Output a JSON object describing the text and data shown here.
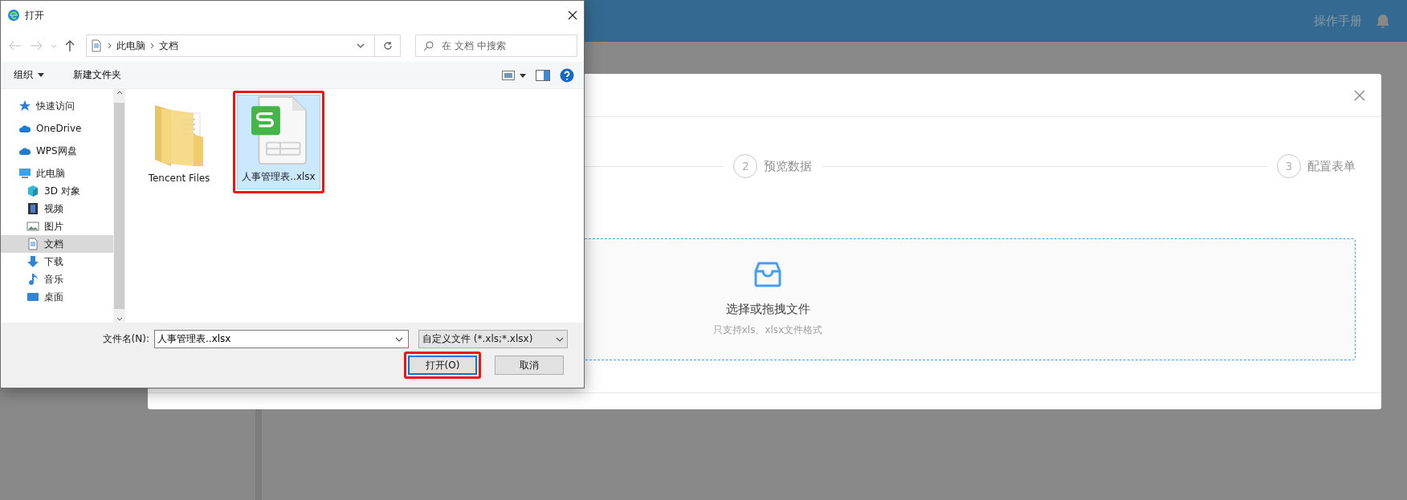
{
  "app_header": {
    "links": [
      "操作手册"
    ]
  },
  "import_modal": {
    "steps": [
      {
        "number": "2",
        "label": "预览数据"
      },
      {
        "number": "3",
        "label": "配置表单"
      }
    ],
    "upload": {
      "title": "选择或拖拽文件",
      "hint": "只支持xls、xlsx文件格式"
    }
  },
  "file_dialog": {
    "title": "打开",
    "path": [
      "此电脑",
      "文档"
    ],
    "search": {
      "placeholder": "在 文档 中搜索"
    },
    "toolbar": [
      {
        "label": "组织",
        "kind": "menu"
      },
      {
        "label": "新建文件夹",
        "kind": "plain"
      }
    ],
    "sidebar": [
      {
        "label": "快速访问",
        "kind": "star",
        "selected": false
      },
      {
        "label": "OneDrive",
        "kind": "cloud",
        "selected": false
      },
      {
        "label": "WPS网盘",
        "kind": "cloud",
        "selected": false
      },
      {
        "label": "此电脑",
        "kind": "computer",
        "selected": false,
        "children": [
          {
            "label": "3D 对象",
            "kind": "cube",
            "selected": false
          },
          {
            "label": "视频",
            "kind": "film",
            "selected": false
          },
          {
            "label": "图片",
            "kind": "picture",
            "selected": false
          },
          {
            "label": "文档",
            "kind": "document",
            "selected": true
          },
          {
            "label": "下载",
            "kind": "download",
            "selected": false
          },
          {
            "label": "音乐",
            "kind": "music",
            "selected": false
          },
          {
            "label": "桌面",
            "kind": "desktop",
            "selected": false
          }
        ]
      }
    ],
    "files": [
      {
        "name": "Tencent Files",
        "kind": "folder",
        "selected": false,
        "annotated": false
      },
      {
        "name": "人事管理表..xlsx",
        "kind": "spreadsheet",
        "selected": true,
        "annotated": true
      }
    ],
    "file_name_label": "文件名(N):",
    "file_name": "人事管理表..xlsx",
    "file_type": "自定义文件 (*.xls;*.xlsx)",
    "buttons": [
      {
        "label": "打开(O)",
        "kind": "primary",
        "annotated": true
      },
      {
        "label": "取消",
        "kind": "secondary",
        "annotated": false
      }
    ]
  }
}
